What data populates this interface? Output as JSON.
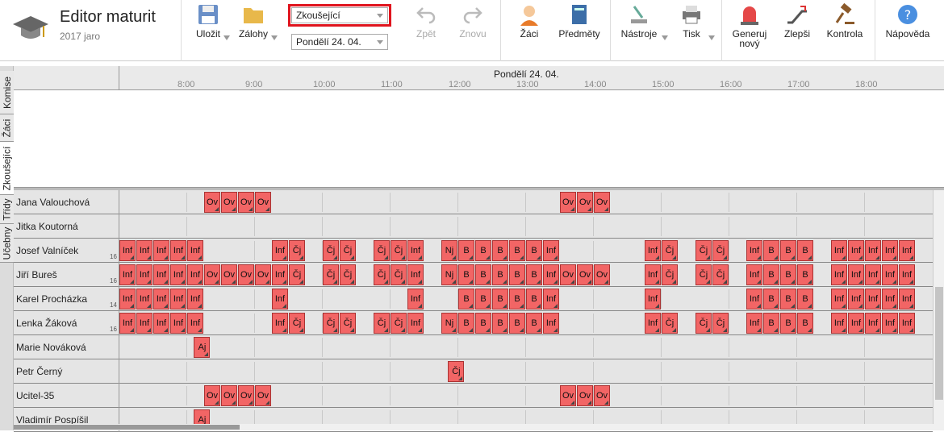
{
  "app": {
    "title": "Editor maturit",
    "subtitle": "2017 jaro"
  },
  "toolbar": {
    "save": "Uložit",
    "backups": "Zálohy",
    "view_select": "Zkoušející",
    "day_select": "Pondělí 24. 04.",
    "undo": "Zpět",
    "redo": "Znovu",
    "students": "Žáci",
    "subjects": "Předměty",
    "tools": "Nástroje",
    "print": "Tisk",
    "generate": "Generuj",
    "generate2": "nový",
    "improve": "Zlepši",
    "check": "Kontrola",
    "help": "Nápověda"
  },
  "sidetabs": [
    "Komise",
    "Žáci",
    "Zkoušející",
    "Třídy",
    "Učebny"
  ],
  "header": {
    "day": "Pondělí 24. 04.",
    "hours": [
      "8:00",
      "9:00",
      "10:00",
      "11:00",
      "12:00",
      "13:00",
      "14:00",
      "15:00",
      "16:00",
      "17:00",
      "18:00"
    ]
  },
  "rows": [
    {
      "name": "Jana Valouchová",
      "count": "",
      "cells": [
        [
          "Ov",
          5
        ],
        [
          "Ov",
          6
        ],
        [
          "Ov",
          7
        ],
        [
          "Ov",
          8
        ],
        [
          "Ov",
          26
        ],
        [
          "Ov",
          27
        ],
        [
          "Ov",
          28
        ]
      ]
    },
    {
      "name": "Jitka Koutorná",
      "count": "",
      "cells": []
    },
    {
      "name": "Josef Valníček",
      "count": "16",
      "cells": [
        [
          "Inf",
          0
        ],
        [
          "Inf",
          1
        ],
        [
          "Inf",
          2
        ],
        [
          "Inf",
          3
        ],
        [
          "Inf",
          4
        ],
        [
          "Inf",
          9
        ],
        [
          "Čj",
          10
        ],
        [
          "Čj",
          12
        ],
        [
          "Čj",
          13
        ],
        [
          "Čj",
          15
        ],
        [
          "Čj",
          16
        ],
        [
          "Inf",
          17
        ],
        [
          "Nj",
          19
        ],
        [
          "B",
          20
        ],
        [
          "B",
          21
        ],
        [
          "B",
          22
        ],
        [
          "B",
          23
        ],
        [
          "B",
          24
        ],
        [
          "Inf",
          25
        ],
        [
          "Inf",
          31
        ],
        [
          "Čj",
          32
        ],
        [
          "Čj",
          34
        ],
        [
          "Čj",
          35
        ],
        [
          "Inf",
          37
        ],
        [
          "B",
          38
        ],
        [
          "B",
          39
        ],
        [
          "B",
          40
        ],
        [
          "Inf",
          42
        ],
        [
          "Inf",
          43
        ],
        [
          "Inf",
          44
        ],
        [
          "Inf",
          45
        ],
        [
          "Inf",
          46
        ]
      ]
    },
    {
      "name": "Jiří Bureš",
      "count": "16",
      "cells": [
        [
          "Inf",
          0
        ],
        [
          "Inf",
          1
        ],
        [
          "Inf",
          2
        ],
        [
          "Inf",
          3
        ],
        [
          "Inf",
          4
        ],
        [
          "Ov",
          5
        ],
        [
          "Ov",
          6
        ],
        [
          "Ov",
          7
        ],
        [
          "Ov",
          8
        ],
        [
          "Inf",
          9
        ],
        [
          "Čj",
          10
        ],
        [
          "Čj",
          12
        ],
        [
          "Čj",
          13
        ],
        [
          "Čj",
          15
        ],
        [
          "Čj",
          16
        ],
        [
          "Inf",
          17
        ],
        [
          "Nj",
          19
        ],
        [
          "B",
          20
        ],
        [
          "B",
          21
        ],
        [
          "B",
          22
        ],
        [
          "B",
          23
        ],
        [
          "B",
          24
        ],
        [
          "Inf",
          25
        ],
        [
          "Ov",
          26
        ],
        [
          "Ov",
          27
        ],
        [
          "Ov",
          28
        ],
        [
          "Inf",
          31
        ],
        [
          "Čj",
          32
        ],
        [
          "Čj",
          34
        ],
        [
          "Čj",
          35
        ],
        [
          "Inf",
          37
        ],
        [
          "B",
          38
        ],
        [
          "B",
          39
        ],
        [
          "B",
          40
        ],
        [
          "Inf",
          42
        ],
        [
          "Inf",
          43
        ],
        [
          "Inf",
          44
        ],
        [
          "Inf",
          45
        ],
        [
          "Inf",
          46
        ]
      ]
    },
    {
      "name": "Karel Procházka",
      "count": "14",
      "cells": [
        [
          "Inf",
          0
        ],
        [
          "Inf",
          1
        ],
        [
          "Inf",
          2
        ],
        [
          "Inf",
          3
        ],
        [
          "Inf",
          4
        ],
        [
          "Inf",
          9
        ],
        [
          "Inf",
          17
        ],
        [
          "B",
          20
        ],
        [
          "B",
          21
        ],
        [
          "B",
          22
        ],
        [
          "B",
          23
        ],
        [
          "B",
          24
        ],
        [
          "Inf",
          25
        ],
        [
          "Inf",
          31
        ],
        [
          "Inf",
          37
        ],
        [
          "B",
          38
        ],
        [
          "B",
          39
        ],
        [
          "B",
          40
        ],
        [
          "Inf",
          42
        ],
        [
          "Inf",
          43
        ],
        [
          "Inf",
          44
        ],
        [
          "Inf",
          45
        ],
        [
          "Inf",
          46
        ]
      ]
    },
    {
      "name": "Lenka Žáková",
      "count": "16",
      "cells": [
        [
          "Inf",
          0
        ],
        [
          "Inf",
          1
        ],
        [
          "Inf",
          2
        ],
        [
          "Inf",
          3
        ],
        [
          "Inf",
          4
        ],
        [
          "Inf",
          9
        ],
        [
          "Čj",
          10
        ],
        [
          "Čj",
          12
        ],
        [
          "Čj",
          13
        ],
        [
          "Čj",
          15
        ],
        [
          "Čj",
          16
        ],
        [
          "Inf",
          17
        ],
        [
          "Nj",
          19
        ],
        [
          "B",
          20
        ],
        [
          "B",
          21
        ],
        [
          "B",
          22
        ],
        [
          "B",
          23
        ],
        [
          "B",
          24
        ],
        [
          "Inf",
          25
        ],
        [
          "Inf",
          31
        ],
        [
          "Čj",
          32
        ],
        [
          "Čj",
          34
        ],
        [
          "Čj",
          35
        ],
        [
          "Inf",
          37
        ],
        [
          "B",
          38
        ],
        [
          "B",
          39
        ],
        [
          "B",
          40
        ],
        [
          "Inf",
          42
        ],
        [
          "Inf",
          43
        ],
        [
          "Inf",
          44
        ],
        [
          "Inf",
          45
        ],
        [
          "Inf",
          46
        ]
      ]
    },
    {
      "name": "Marie Nováková",
      "count": "",
      "cells": [
        [
          "Aj",
          4.4
        ]
      ]
    },
    {
      "name": "Petr Černý",
      "count": "",
      "cells": [
        [
          "Čj",
          19.4
        ]
      ]
    },
    {
      "name": "Ucitel-35",
      "count": "",
      "cells": [
        [
          "Ov",
          5
        ],
        [
          "Ov",
          6
        ],
        [
          "Ov",
          7
        ],
        [
          "Ov",
          8
        ],
        [
          "Ov",
          26
        ],
        [
          "Ov",
          27
        ],
        [
          "Ov",
          28
        ]
      ]
    },
    {
      "name": "Vladimír Pospíšil",
      "count": "",
      "cells": [
        [
          "Aj",
          4.4
        ]
      ]
    }
  ],
  "colors": {
    "cell": "#f26565",
    "highlight": "#e0141e"
  }
}
